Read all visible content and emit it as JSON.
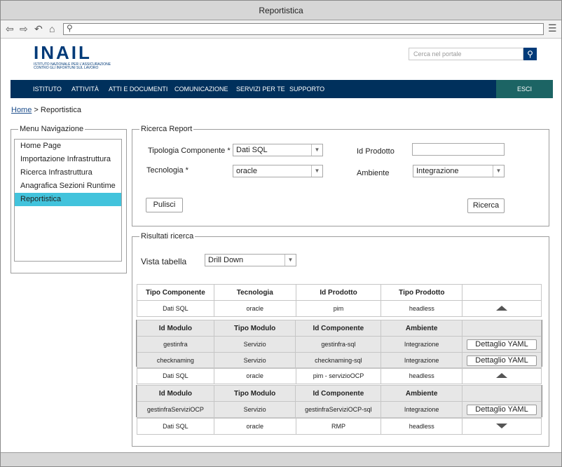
{
  "window": {
    "title": "Reportistica"
  },
  "header": {
    "logo_text": "INAIL",
    "logo_subtitle": "ISTITUTO NAZIONALE PER L'ASSICURAZIONE CONTRO GLI INFORTUNI SUL LAVORO",
    "search_placeholder": "Cerca nel portale"
  },
  "mainnav": {
    "items": [
      "ISTITUTO",
      "ATTIVITÀ",
      "ATTI E DOCUMENTI",
      "COMUNICAZIONE",
      "SERVIZI PER TE",
      "SUPPORTO"
    ],
    "logout": "ESCI"
  },
  "breadcrumb": {
    "home": "Home",
    "separator": ">",
    "current": "Reportistica"
  },
  "sidebar": {
    "legend": "Menu Navigazione",
    "items": [
      "Home Page",
      "Importazione Infrastruttura",
      "Ricerca Infrastruttura",
      "Anagrafica Sezioni Runtime",
      "Reportistica"
    ],
    "selected_index": 4
  },
  "search": {
    "legend": "Ricerca Report",
    "tipologia_label": "Tipologia Componente *",
    "tipologia_value": "Dati SQL",
    "tecnologia_label": "Tecnologia *",
    "tecnologia_value": "oracle",
    "id_prodotto_label": "Id Prodotto",
    "id_prodotto_value": "",
    "ambiente_label": "Ambiente",
    "ambiente_value": "Integrazione",
    "clear_button": "Pulisci",
    "search_button": "Ricerca"
  },
  "results": {
    "legend": "Risultati ricerca",
    "view_label": "Vista tabella",
    "view_value": "Drill Down",
    "headers": [
      "Tipo Componente",
      "Tecnologia",
      "Id Prodotto",
      "Tipo Prodotto"
    ],
    "sub_headers": [
      "Id Modulo",
      "Tipo Modulo",
      "Id Componente",
      "Ambiente"
    ],
    "yaml_button": "Dettaglio YAML",
    "rows": [
      {
        "tipo": "Dati SQL",
        "tecnologia": "oracle",
        "id_prodotto": "pim",
        "tipo_prodotto": "headless",
        "expanded": true,
        "modules": [
          {
            "id_modulo": "gestinfra",
            "tipo_modulo": "Servizio",
            "id_componente": "gestinfra-sql",
            "ambiente": "Integrazione"
          },
          {
            "id_modulo": "checknaming",
            "tipo_modulo": "Servizio",
            "id_componente": "checknaming-sql",
            "ambiente": "Integrazione"
          }
        ]
      },
      {
        "tipo": "Dati SQL",
        "tecnologia": "oracle",
        "id_prodotto": "pim - servizioOCP",
        "tipo_prodotto": "headless",
        "expanded": true,
        "modules": [
          {
            "id_modulo": "gestinfraServiziOCP",
            "tipo_modulo": "Servizio",
            "id_componente": "gestinfraServiziOCP-sql",
            "ambiente": "Integrazione"
          }
        ]
      },
      {
        "tipo": "Dati SQL",
        "tecnologia": "oracle",
        "id_prodotto": "RMP",
        "tipo_prodotto": "headless",
        "expanded": false,
        "modules": []
      }
    ]
  }
}
